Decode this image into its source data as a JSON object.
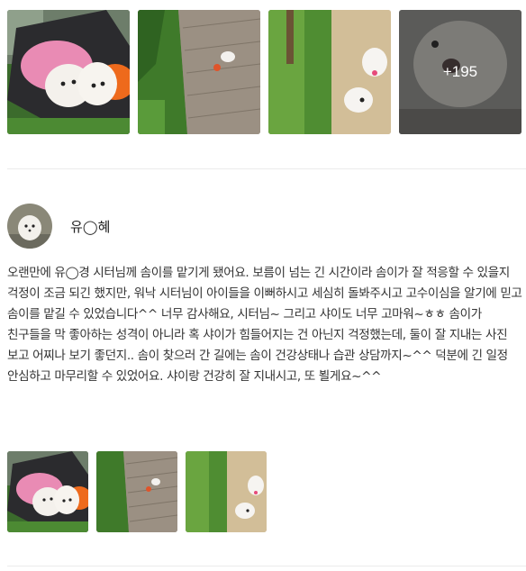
{
  "gallery": {
    "thumbnails": [
      {
        "icon": "dogs-in-pink-stroller-photo"
      },
      {
        "icon": "dog-on-brick-path-photo"
      },
      {
        "icon": "dogs-on-dirt-path-photo"
      },
      {
        "icon": "dog-closeup-photo"
      }
    ],
    "more_count": "+195"
  },
  "review": {
    "reviewer_name": "유◯혜",
    "avatar_icon": "white-dog-avatar",
    "text": "오랜만에 유◯경 시터님께 솜이를 맡기게 됐어요. 보름이 넘는 긴 시간이라 솜이가 잘 적응할 수 있을지 걱정이 조금 되긴 했지만, 워낙 시터님이 아이들을 이뻐하시고 세심히 돌봐주시고 고수이심을 알기에 믿고 솜이를 맡길 수 있었습니다^^ 너무 감사해요, 시터님~ 그리고 샤이도 너무 고마워~ㅎㅎ 솜이가 친구들을 막 좋아하는 성격이 아니라 혹 샤이가 힘들어지는 건 아닌지 걱정했는데, 둘이 잘 지내는 사진 보고 어찌나 보기 좋던지.. 솜이 찾으러 간 길에는 솜이 건강상태나 습관 상담까지~^^ 덕분에 긴 일정 안심하고 마무리할 수 있었어요. 샤이랑 건강히 잘 지내시고, 또 뵐게요~^^",
    "photos": [
      {
        "icon": "dogs-in-pink-stroller-photo"
      },
      {
        "icon": "dog-on-brick-path-photo"
      },
      {
        "icon": "dogs-on-dirt-path-photo"
      }
    ]
  }
}
